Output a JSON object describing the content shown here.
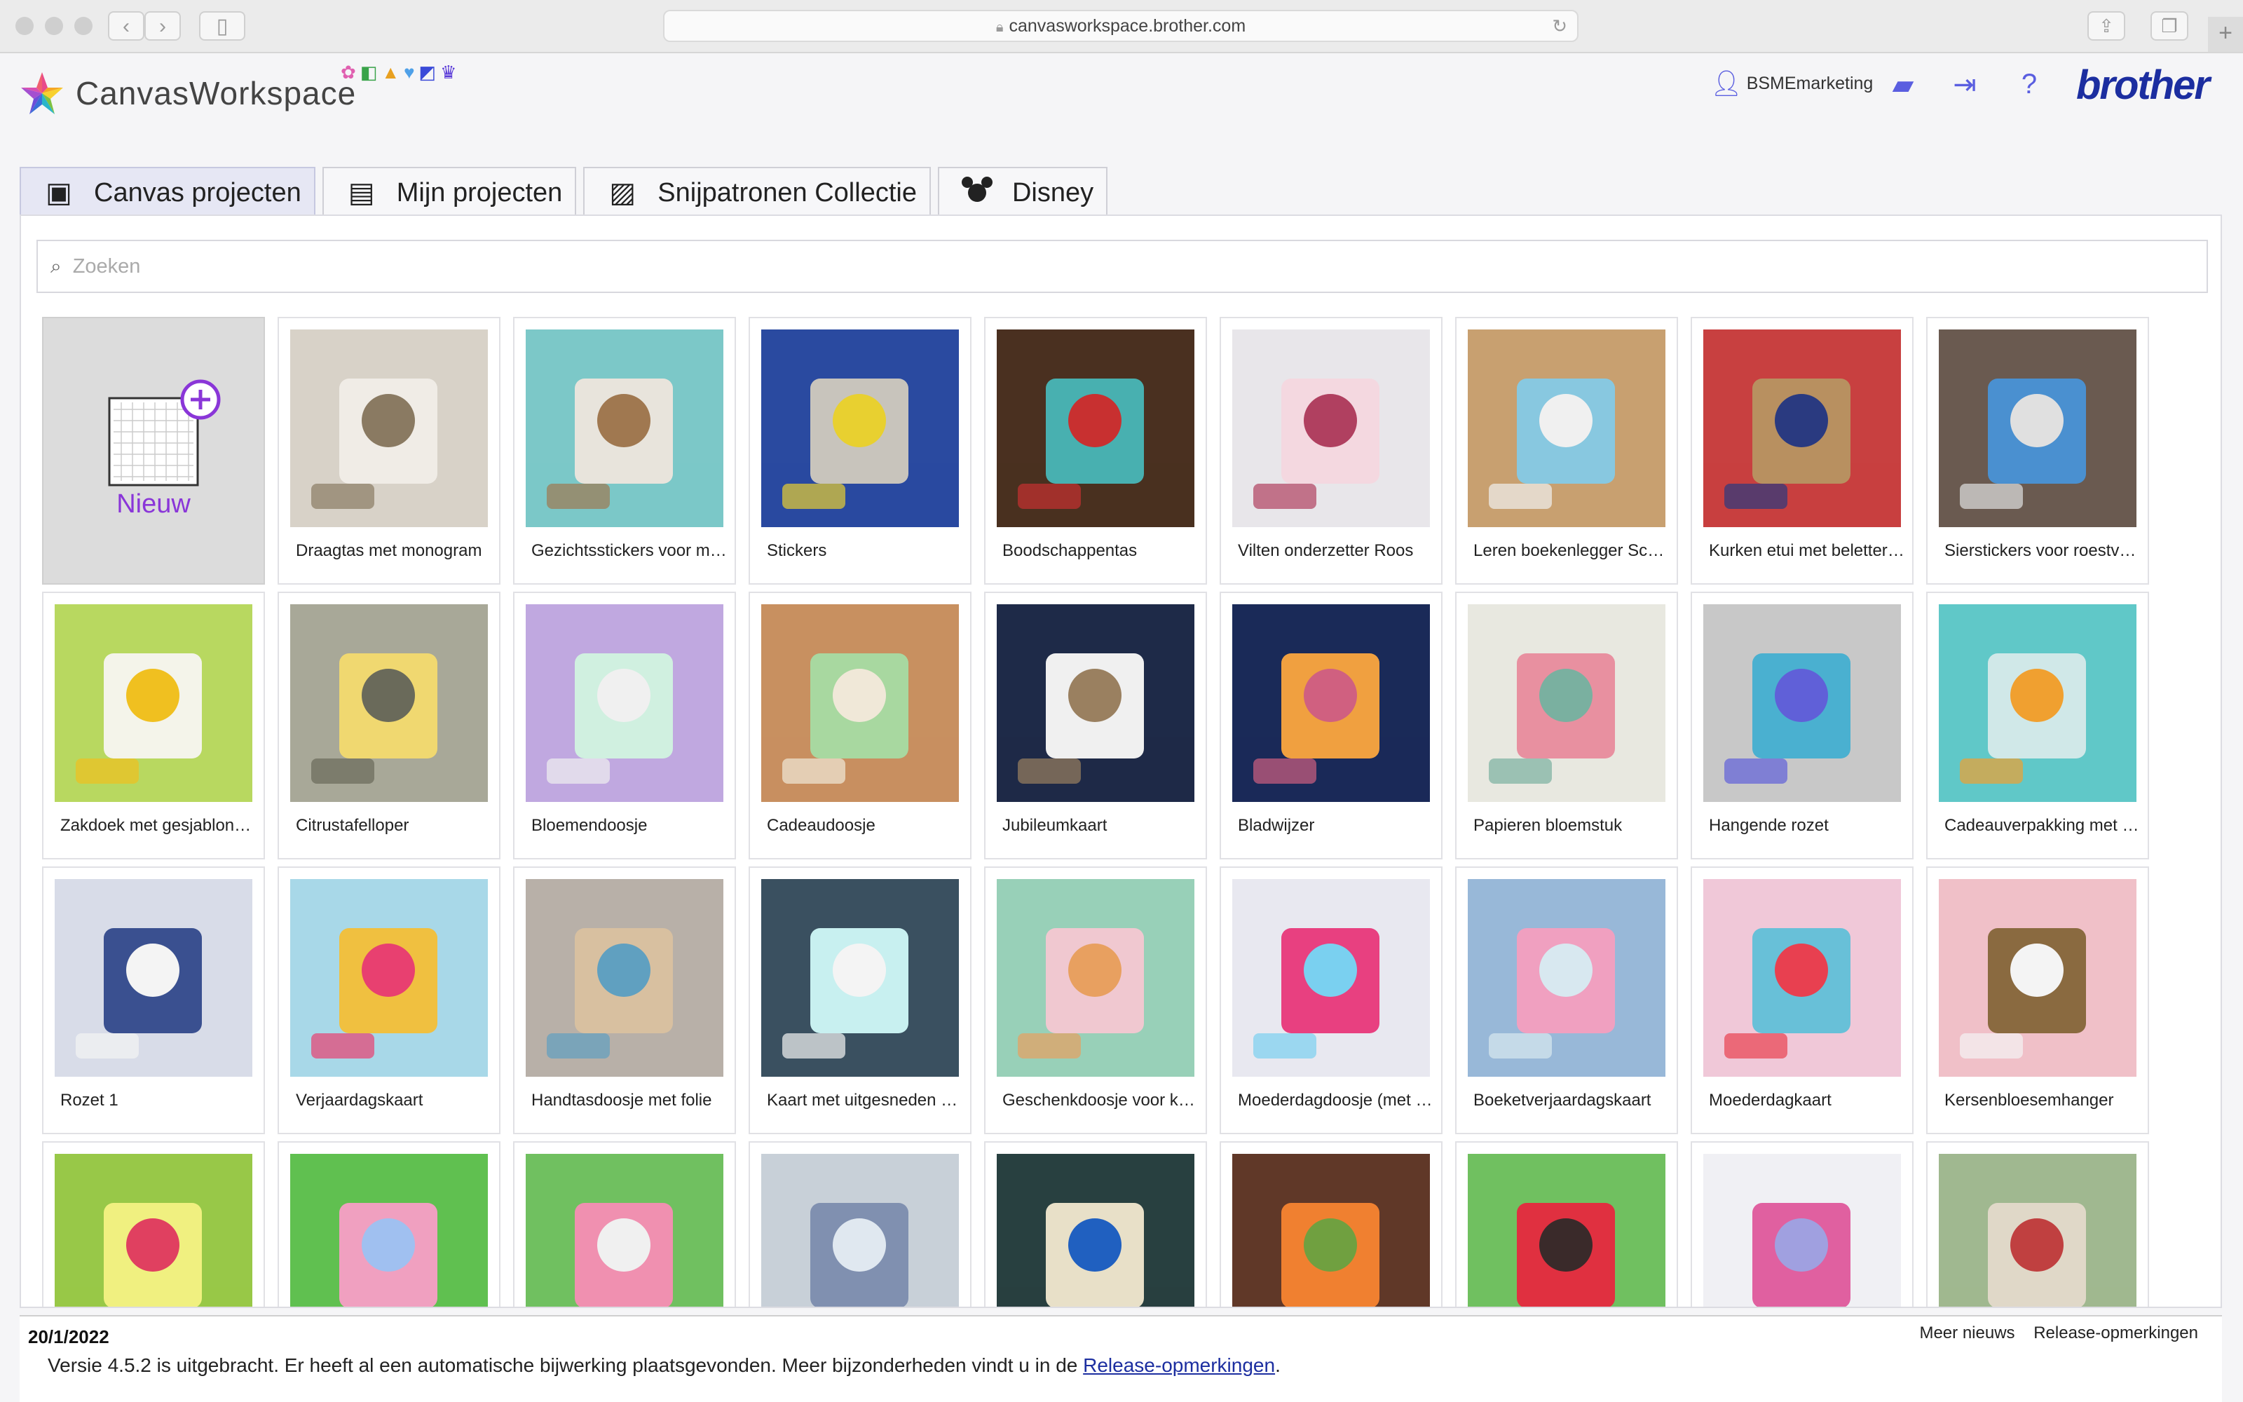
{
  "browser": {
    "url": "canvasworkspace.brother.com"
  },
  "header": {
    "app_name": "CanvasWorkspace",
    "username": "BSMEmarketing",
    "brand": "brother",
    "accent_color": "#5a5ee0",
    "brand_color": "#1c2ea0"
  },
  "tabs": [
    {
      "label": "Canvas projecten",
      "icon": "canvas-projects-icon",
      "active": true
    },
    {
      "label": "Mijn projecten",
      "icon": "my-projects-icon",
      "active": false
    },
    {
      "label": "Snijpatronen Collectie",
      "icon": "cut-patterns-icon",
      "active": false
    },
    {
      "label": "Disney",
      "icon": "disney-icon",
      "active": false
    }
  ],
  "search": {
    "placeholder": "Zoeken"
  },
  "new_card": {
    "label": "Nieuw",
    "color": "#8a36d8"
  },
  "projects": [
    {
      "label": "Draagtas met monogram"
    },
    {
      "label": "Gezichtsstickers voor mokken"
    },
    {
      "label": "Stickers"
    },
    {
      "label": "Boodschappentas"
    },
    {
      "label": "Vilten onderzetter Roos"
    },
    {
      "label": "Leren boekenlegger Schoolbord"
    },
    {
      "label": "Kurken etui met belettering"
    },
    {
      "label": "Sierstickers voor roestvrijstalen fles"
    },
    {
      "label": "Zakdoek met gesjabloneerd motief"
    },
    {
      "label": "Citrustafelloper"
    },
    {
      "label": "Bloemendoosje"
    },
    {
      "label": "Cadeaudoosje"
    },
    {
      "label": "Jubileumkaart"
    },
    {
      "label": "Bladwijzer"
    },
    {
      "label": "Papieren bloemstuk"
    },
    {
      "label": "Hangende rozet"
    },
    {
      "label": "Cadeauverpakking met handvat"
    },
    {
      "label": "Rozet 1"
    },
    {
      "label": "Verjaardagskaart"
    },
    {
      "label": "Handtasdoosje met folie"
    },
    {
      "label": "Kaart met uitgesneden bloemen"
    },
    {
      "label": "Geschenkdoosje voor koekjes"
    },
    {
      "label": "Moederdagdoosje (met bloemen)"
    },
    {
      "label": "Boeketverjaardagskaart"
    },
    {
      "label": "Moederdagkaart"
    },
    {
      "label": "Kersenbloesemhanger"
    },
    {
      "label": ""
    },
    {
      "label": ""
    },
    {
      "label": ""
    },
    {
      "label": ""
    },
    {
      "label": ""
    },
    {
      "label": ""
    },
    {
      "label": ""
    },
    {
      "label": ""
    },
    {
      "label": ""
    }
  ],
  "news": {
    "date": "20/1/2022",
    "message": "Versie 4.5.2 is uitgebracht. Er heeft al een automatische bijwerking plaatsgevonden. Meer bijzonderheden vindt u in de",
    "link": "Release-opmerkingen",
    "link_suffix": ".",
    "more_news": "Meer nieuws",
    "release_notes": "Release-opmerkingen"
  }
}
